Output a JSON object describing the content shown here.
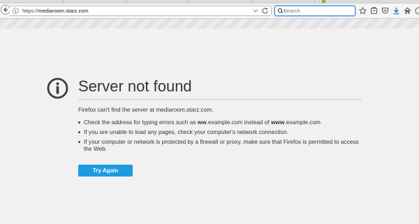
{
  "browser": {
    "url_prefix": "https://",
    "url_host": "mediaroom.starz.com",
    "search_placeholder": "Search",
    "toolbar_icons": [
      "star-icon",
      "reading-list-icon",
      "pocket-icon",
      "download-icon",
      "home-icon",
      "chat-icon"
    ]
  },
  "error_page": {
    "title": "Server not found",
    "lead": "Firefox can't find the server at mediaroom.starz.com.",
    "tips": [
      {
        "before": "Check the address for typing errors such as ",
        "bold1": "ww",
        "mid1": ".example.com instead of ",
        "bold2": "www",
        "mid2": ".example.com"
      },
      {
        "text": "If you are unable to load any pages, check your computer's network connection."
      },
      {
        "text": "If your computer or network is protected by a firewall or proxy, make sure that Firefox is permitted to access the Web."
      }
    ],
    "button_label": "Try Again",
    "accent_color": "#1d9be0"
  }
}
